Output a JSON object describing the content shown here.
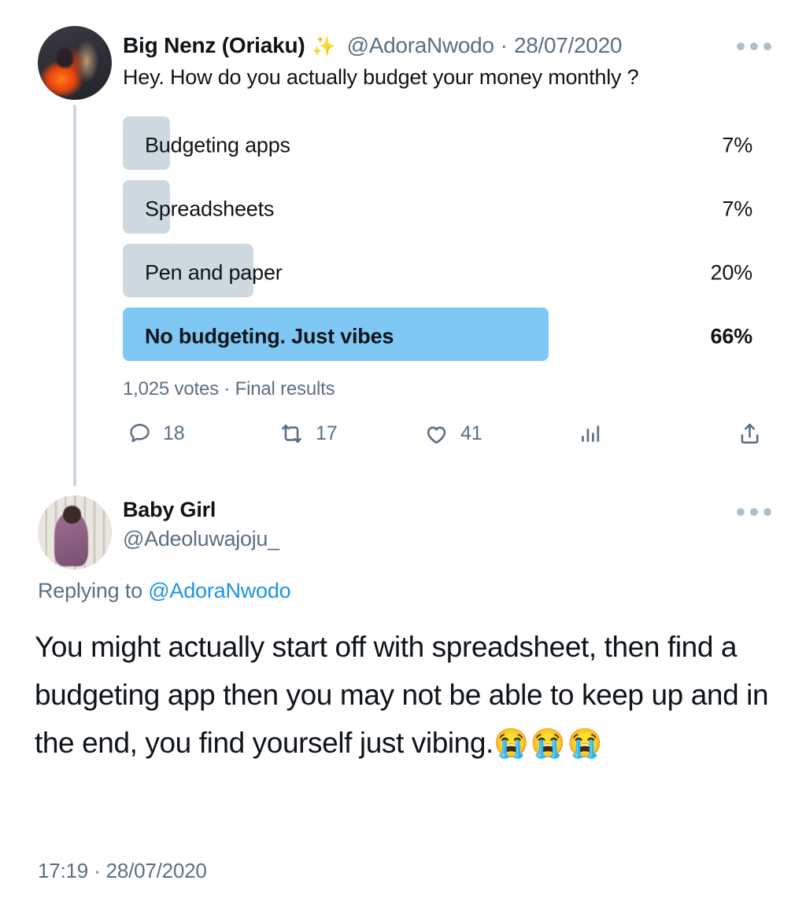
{
  "thread": {
    "tweets": [
      {
        "author": {
          "display_name": "Big Nenz (Oriaku)",
          "badge_emoji": "✨",
          "handle": "@AdoraNwodo",
          "avatar_name": "avatar-big-nenz"
        },
        "separator": "·",
        "date": "28/07/2020",
        "more_label": "More",
        "text": "Hey. How do you actually budget your money monthly ?",
        "poll": {
          "options": [
            {
              "label": "Budgeting apps",
              "percent": "7%",
              "value": 7,
              "winner": false
            },
            {
              "label": "Spreadsheets",
              "percent": "7%",
              "value": 7,
              "winner": false
            },
            {
              "label": "Pen and paper",
              "percent": "20%",
              "value": 20,
              "winner": false
            },
            {
              "label": "No budgeting. Just vibes",
              "percent": "66%",
              "value": 66,
              "winner": true
            }
          ],
          "meta": "1,025 votes · Final results",
          "votes_total": "1,025",
          "status": "Final results",
          "bar_color": "#cfd9e0",
          "winner_bar_color": "#7fc8f4"
        },
        "actions": [
          {
            "icon": "reply-icon",
            "count": "18"
          },
          {
            "icon": "retweet-icon",
            "count": "17"
          },
          {
            "icon": "like-icon",
            "count": "41"
          },
          {
            "icon": "analytics-icon",
            "count": ""
          },
          {
            "icon": "share-icon",
            "count": ""
          }
        ]
      },
      {
        "author": {
          "display_name": "Baby Girl",
          "handle": "@Adeoluwajoju_",
          "avatar_name": "avatar-baby-girl"
        },
        "more_label": "More",
        "replying_to_prefix": "Replying to ",
        "replying_to_mention": "@AdoraNwodo",
        "text": "You might actually start off with spreadsheet, then find a budgeting app then you may not be able to keep up and in the end, you find yourself just vibing.",
        "text_emojis": "😭😭😭",
        "timestamp": "17:19 · 28/07/2020"
      }
    ]
  },
  "colors": {
    "link": "#1b95e0",
    "muted_text": "#5b7083",
    "primary_text": "#0f1419",
    "thread_line": "#ccd6dd",
    "poll_bar": "#cfd9e0",
    "poll_winner_bar": "#7fc8f4"
  }
}
